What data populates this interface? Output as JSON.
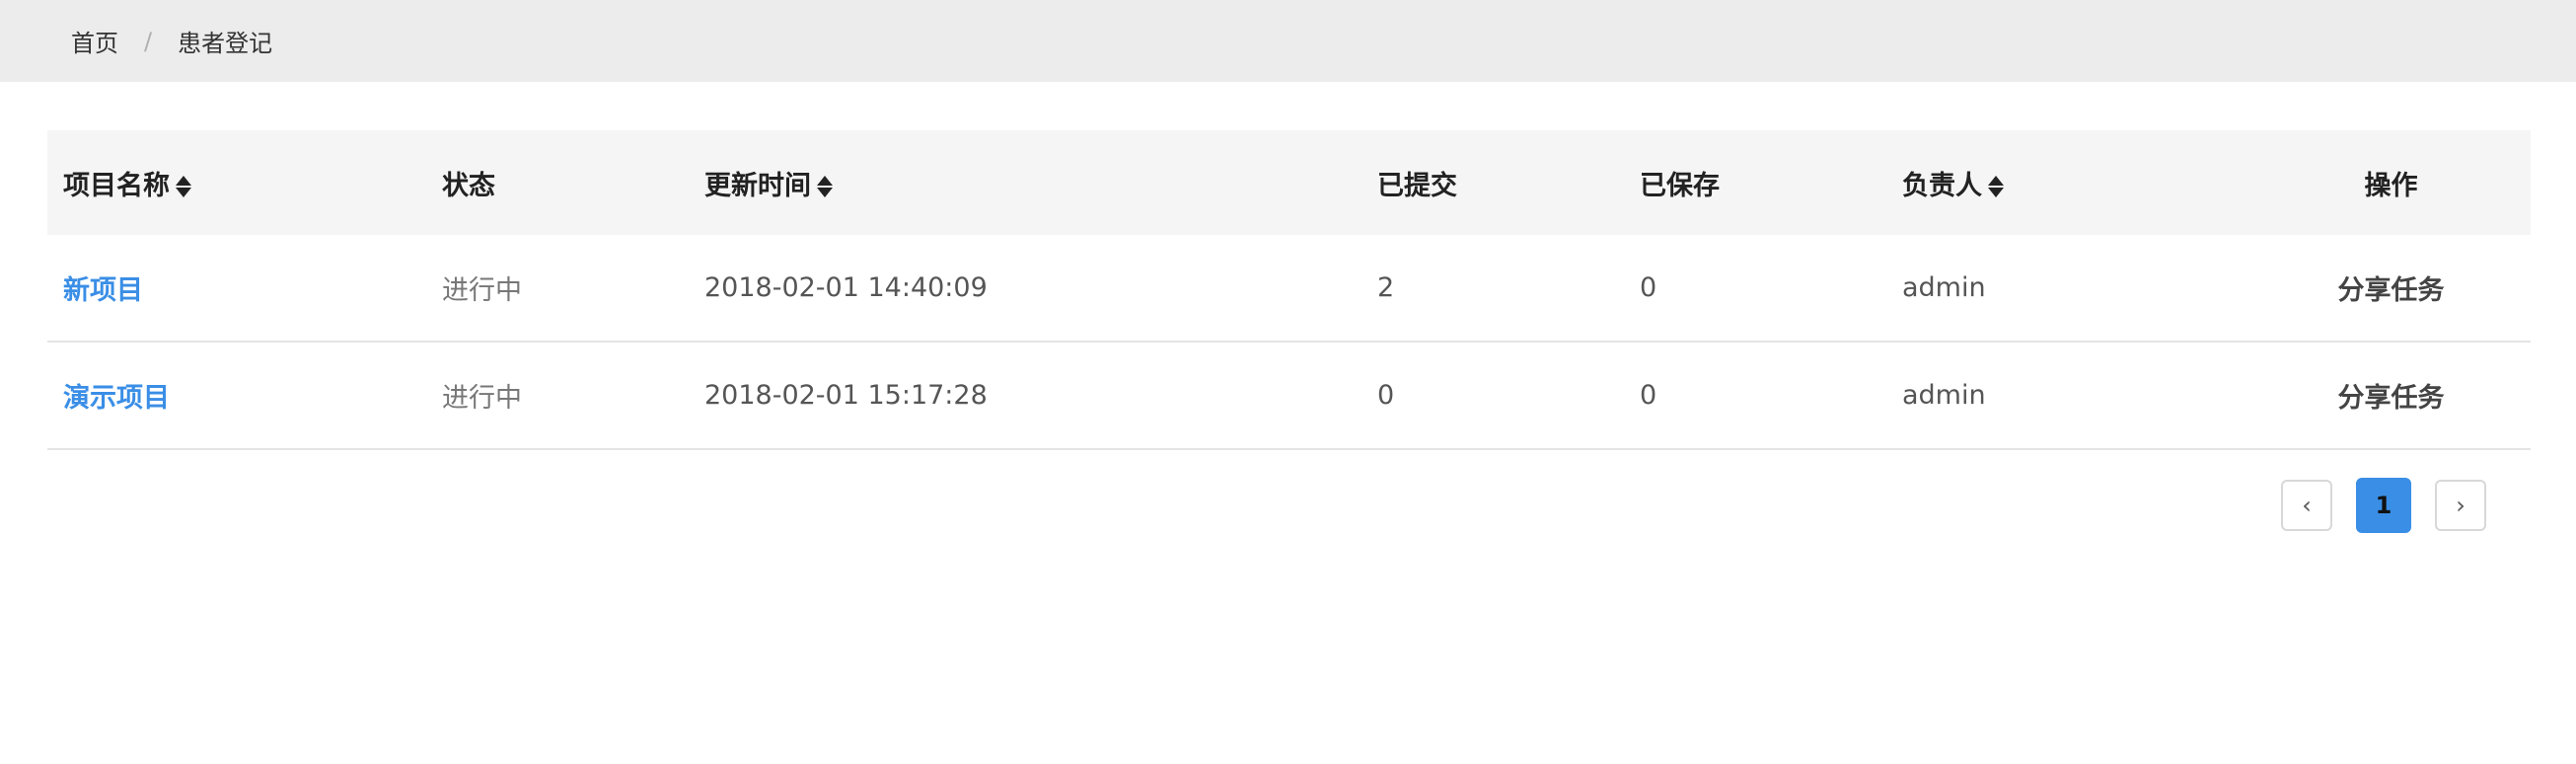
{
  "breadcrumb": {
    "home": "首页",
    "separator": "/",
    "current": "患者登记"
  },
  "table": {
    "columns": [
      {
        "label": "项目名称",
        "sortable": true
      },
      {
        "label": "状态",
        "sortable": false
      },
      {
        "label": "更新时间",
        "sortable": true
      },
      {
        "label": "已提交",
        "sortable": false
      },
      {
        "label": "已保存",
        "sortable": false
      },
      {
        "label": "负责人",
        "sortable": true
      },
      {
        "label": "操作",
        "sortable": false
      }
    ],
    "rows": [
      {
        "name": "新项目",
        "status": "进行中",
        "updated": "2018-02-01 14:40:09",
        "submitted": "2",
        "saved": "0",
        "owner": "admin",
        "action": "分享任务"
      },
      {
        "name": "演示项目",
        "status": "进行中",
        "updated": "2018-02-01 15:17:28",
        "submitted": "0",
        "saved": "0",
        "owner": "admin",
        "action": "分享任务"
      }
    ]
  },
  "pagination": {
    "prev": "‹",
    "current": "1",
    "next": "›"
  },
  "colors": {
    "link": "#3a8ee6",
    "active_page": "#3a8ee6",
    "header_bg": "#f5f5f5",
    "breadcrumb_bg": "#ececec"
  }
}
